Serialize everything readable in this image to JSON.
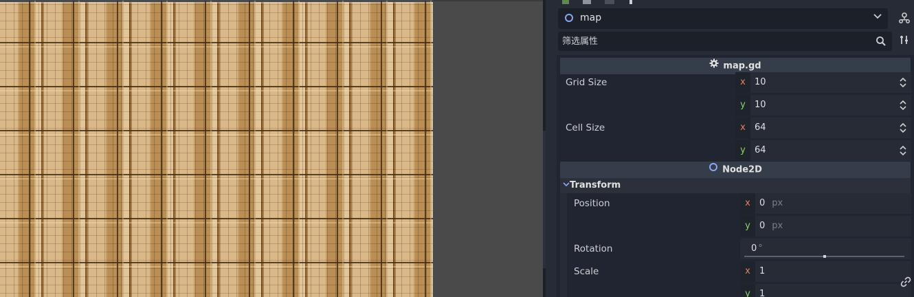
{
  "inspector": {
    "node_name": "map",
    "filter_placeholder": "筛选属性",
    "script_section": {
      "title": "map.gd",
      "properties": [
        {
          "label": "Grid Size",
          "x": "10",
          "y": "10"
        },
        {
          "label": "Cell Size",
          "x": "64",
          "y": "64"
        }
      ]
    },
    "node_section": {
      "title": "Node2D",
      "group": "Transform",
      "position": {
        "label": "Position",
        "x": "0",
        "y": "0",
        "unit": "px"
      },
      "rotation": {
        "label": "Rotation",
        "value": "0",
        "unit": "°",
        "slider_fraction": 0.5
      },
      "scale": {
        "label": "Scale",
        "x": "1",
        "y": "1"
      }
    },
    "axis_labels": {
      "x": "x",
      "y": "y"
    }
  },
  "colors": {
    "panel_bg": "#202531",
    "section_bg": "#363d4a",
    "axis_x": "#e27f6c",
    "axis_y": "#8fd16f",
    "node_icon": "#8da5f3"
  }
}
